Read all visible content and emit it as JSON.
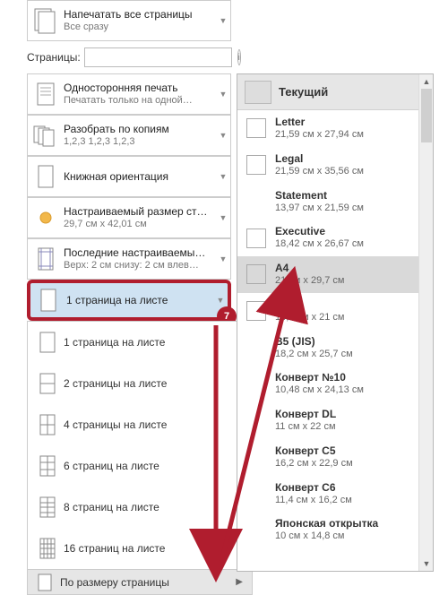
{
  "badge": "7",
  "pages": {
    "label": "Страницы:",
    "value": ""
  },
  "info": "i",
  "options": [
    {
      "title": "Напечатать все страницы",
      "sub": "Все сразу"
    },
    {
      "title": "Односторонняя печать",
      "sub": "Печатать только на одной…"
    },
    {
      "title": "Разобрать по копиям",
      "sub": "1,2,3    1,2,3    1,2,3"
    },
    {
      "title": "Книжная ориентация",
      "sub": ""
    },
    {
      "title": "Настраиваемый размер ст…",
      "sub": "29,7 см x 42,01 см"
    },
    {
      "title": "Последние настраиваемы…",
      "sub": "Верх: 2 см снизу: 2 см влев…"
    },
    {
      "title": "1 страница на листе",
      "sub": ""
    }
  ],
  "perSheet": [
    "1 страница на листе",
    "2 страницы на листе",
    "4 страницы на листе",
    "6 страниц на листе",
    "8 страниц на листе",
    "16 страниц на листе"
  ],
  "perSheetFooter": "По размеру страницы",
  "paper": {
    "current": "Текущий",
    "items": [
      {
        "name": "Letter",
        "dim": "21,59 см x 27,94 см",
        "chk": true
      },
      {
        "name": "Legal",
        "dim": "21,59 см x 35,56 см",
        "chk": true
      },
      {
        "name": "Statement",
        "dim": "13,97 см x 21,59 см",
        "chk": false
      },
      {
        "name": "Executive",
        "dim": "18,42 см x 26,67 см",
        "chk": true
      },
      {
        "name": "A4",
        "dim": "21 см x 29,7 см",
        "chk": true,
        "sel": true
      },
      {
        "name": "A5",
        "dim": "14,8 см x 21 см",
        "chk": true
      },
      {
        "name": "B5 (JIS)",
        "dim": "18,2 см x 25,7 см",
        "chk": false
      },
      {
        "name": "Конверт №10",
        "dim": "10,48 см x 24,13 см",
        "chk": false
      },
      {
        "name": "Конверт DL",
        "dim": "11 см x 22 см",
        "chk": false
      },
      {
        "name": "Конверт C5",
        "dim": "16,2 см x 22,9 см",
        "chk": false
      },
      {
        "name": "Конверт C6",
        "dim": "11,4 см x 16,2 см",
        "chk": false
      },
      {
        "name": "Японская открытка",
        "dim": "10 см x 14,8 см",
        "chk": false
      }
    ]
  }
}
